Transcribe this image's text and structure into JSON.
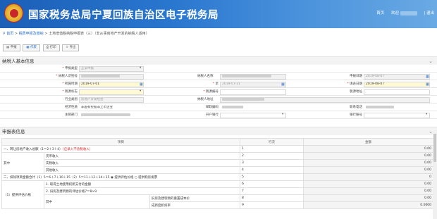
{
  "header": {
    "title": "国家税务总局宁夏回族自治区电子税务局",
    "nav": {
      "home": "首页",
      "welcome": "欢迎",
      "logout": "退出"
    }
  },
  "breadcrumb": {
    "home": "首页",
    "sep": ">",
    "level2": "税费申报及缴纳",
    "level3": "土地增值税纳税申报表（三）（非从事房地产开发的纳税人适用）"
  },
  "toolbar": {
    "buttons": [
      "申报",
      "作废",
      "打印",
      "导出"
    ]
  },
  "section_basic": {
    "title": "纳税人基本信息",
    "r1": {
      "label": "申报类型",
      "value": "正常申报"
    },
    "r2": {
      "label_a": "纳税人识别号",
      "label_b": "纳税人名称",
      "label_c": "申报日期",
      "date": "2019-08-07"
    },
    "r3": {
      "label_a": "所属时期",
      "from": "2019-07-01",
      "label_b": "至",
      "to": "2019-07-31",
      "label_c": "填表日期",
      "fill_date": "2019-08-07"
    },
    "r4": {
      "label_a": "税源标志",
      "label_b": "税源编号",
      "label_c": "税源地址"
    },
    "r5": {
      "label_a": "行业类别",
      "industry": "房地产开发经营",
      "label_b": "纳税人地址"
    },
    "r6": {
      "label_a": "经济性质",
      "nature": "非国有控股非上市企业",
      "label_b": "邮政编码",
      "label_c": "联系电话"
    },
    "r7": {
      "label_a": "主管部门",
      "label_b": "开户银行",
      "label_c": "银行账号"
    }
  },
  "section_report": {
    "title": "申报表信息",
    "headers": {
      "item": "项目",
      "row": "行次",
      "amount": "金额"
    },
    "rows": [
      {
        "c1": "一、转让房地产收入总额（1＝2＋3＋4）",
        "note": "（应录入不含税收入）",
        "c2": "",
        "row": "1",
        "amt": "0.00"
      },
      {
        "c1": "",
        "c2": "货币收入",
        "row": "2",
        "amt": "0.00"
      },
      {
        "c1": "其中",
        "c2": "实物收入",
        "row": "3",
        "amt": "0.00"
      },
      {
        "c1": "",
        "c2": "其他收入",
        "row": "4",
        "amt": "0.00"
      },
      {
        "c1": "二、扣除项目金额合计（1）5＝6＋7＋10＋15（2）5＝11＋12＋14＋15",
        "radio1": "提供评估价格",
        "radio2": "提供购房发票",
        "row": "5",
        "amt": "0"
      },
      {
        "c1": "",
        "c2": "1. 取得土地使用权所支付的金额",
        "row": "6",
        "amt": "0.00"
      },
      {
        "c1": "",
        "c2": "2. 旧房及建筑物的评估价格7＝8×9",
        "row": "7",
        "amt": "0.00"
      },
      {
        "c1": "（1）提供评估价格",
        "c2": "其中",
        "c3": "旧房及建筑物的重置成本价",
        "row": "8",
        "amt": "0.00"
      },
      {
        "c1": "",
        "c2": "",
        "c3": "成新度折扣率",
        "row": "9",
        "amt": "0.0000"
      }
    ]
  },
  "colors": {
    "header": "#2a77cf",
    "required": "#d22",
    "date_bg": "#fff9d6"
  }
}
